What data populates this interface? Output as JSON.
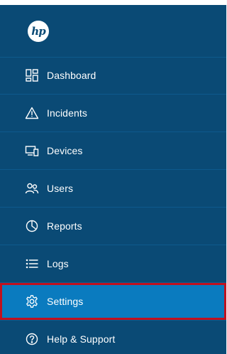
{
  "brand": {
    "logo_text": "hp"
  },
  "sidebar": {
    "items": [
      {
        "label": "Dashboard",
        "icon": "dashboard-icon",
        "active": false
      },
      {
        "label": "Incidents",
        "icon": "warning-triangle-icon",
        "active": false
      },
      {
        "label": "Devices",
        "icon": "devices-icon",
        "active": false
      },
      {
        "label": "Users",
        "icon": "users-icon",
        "active": false
      },
      {
        "label": "Reports",
        "icon": "pie-chart-icon",
        "active": false
      },
      {
        "label": "Logs",
        "icon": "list-icon",
        "active": false
      },
      {
        "label": "Settings",
        "icon": "gear-icon",
        "active": true
      },
      {
        "label": "Help & Support",
        "icon": "help-circle-icon",
        "active": false
      }
    ]
  },
  "colors": {
    "sidebar_background": "#0a4a75",
    "active_background": "#0a7bbf",
    "highlight_border": "#c0111f",
    "text": "#ffffff"
  }
}
